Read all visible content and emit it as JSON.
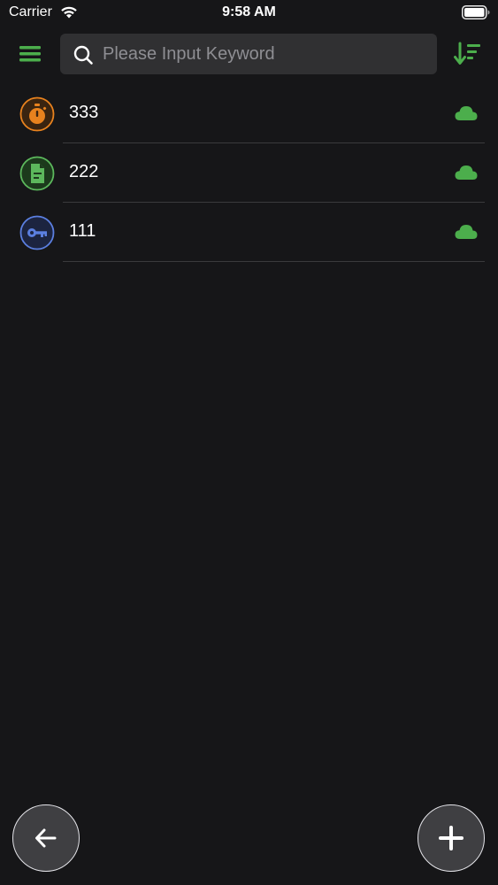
{
  "status_bar": {
    "carrier": "Carrier",
    "time": "9:58 AM"
  },
  "toolbar": {
    "menu_icon": "hamburger-menu-icon",
    "search_placeholder": "Please Input Keyword",
    "search_value": "",
    "sort_icon": "sort-descending-icon"
  },
  "items": [
    {
      "label": "333",
      "icon": "stopwatch-icon",
      "color": "#e8821e",
      "sync_icon": "cloud-icon"
    },
    {
      "label": "222",
      "icon": "document-icon",
      "color": "#5cb85c",
      "sync_icon": "cloud-icon"
    },
    {
      "label": "111",
      "icon": "key-icon",
      "color": "#5b7fe0",
      "sync_icon": "cloud-icon"
    }
  ],
  "buttons": {
    "back_icon": "arrow-left-icon",
    "add_icon": "plus-icon"
  },
  "colors": {
    "accent_green": "#4cae4c",
    "background": "#161618",
    "search_bg": "#303032"
  }
}
